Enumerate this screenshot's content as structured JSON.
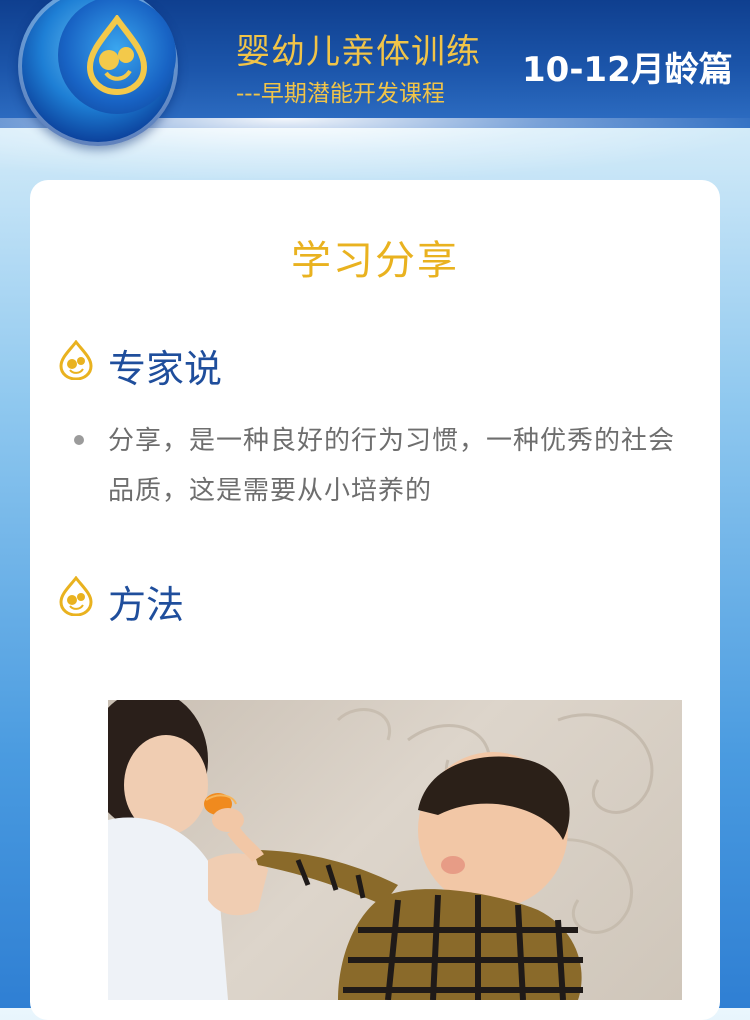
{
  "header": {
    "title": "婴幼儿亲体训练",
    "subtitle": "---早期潜能开发课程",
    "age_range": "10-12月龄篇"
  },
  "card": {
    "title": "学习分享",
    "sections": [
      {
        "label": "专家说",
        "bullets": [
          "分享，是一种良好的行为习惯，一种优秀的社会品质，这是需要从小培养的"
        ]
      },
      {
        "label": "方法"
      }
    ]
  },
  "colors": {
    "header_blue": "#1c56ab",
    "title_gold": "#f1c448",
    "section_blue": "#1f4e9c",
    "card_title_gold": "#e9b21f"
  },
  "icons": [
    "logo-drop-icon",
    "section-drop-icon"
  ]
}
